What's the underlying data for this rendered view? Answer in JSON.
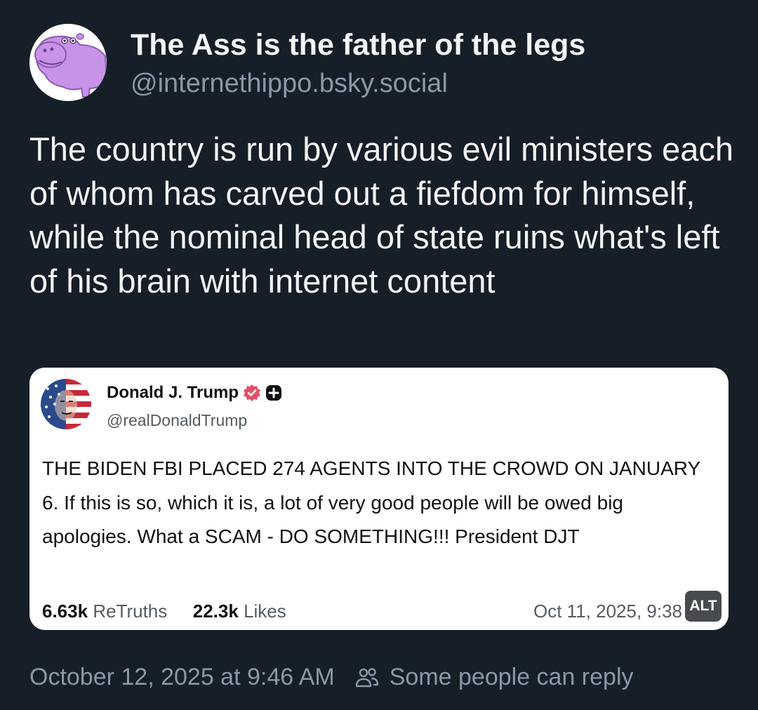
{
  "post": {
    "author": {
      "display_name": "The Ass is the father of the legs",
      "handle": "@internethippo.bsky.social",
      "avatar_icon": "hippo-avatar-icon"
    },
    "text": "The country is run by various evil ministers each of whom has carved out a fiefdom for himself, while the nominal head of state ruins what's left of his brain with internet content",
    "timestamp": "October 12, 2025 at 9:46 AM",
    "reply_setting": "Some people can reply",
    "reply_setting_icon": "people-icon"
  },
  "embedded_image": {
    "alt_badge": "ALT",
    "author": {
      "display_name": "Donald J. Trump",
      "handle": "@realDonaldTrump",
      "verified_icon": "verified-badge-icon",
      "extra_icon": "plus-badge-icon"
    },
    "text": "THE BIDEN FBI PLACED 274 AGENTS INTO THE CROWD ON JANUARY 6. If this is so, which it is, a lot of very good people will be owed big apologies. What a SCAM - DO SOMETHING!!! President DJT",
    "retruths_count": "6.63k",
    "retruths_label": "ReTruths",
    "likes_count": "22.3k",
    "likes_label": "Likes",
    "posted_time": "Oct 11, 2025, 9:38"
  },
  "colors": {
    "background": "#161e27",
    "primary_text": "#f1f3f5",
    "secondary_text": "#8c98a8",
    "card_background": "#ffffff",
    "verified_badge": "#e0506a",
    "hippo_purple": "#c792e8"
  }
}
